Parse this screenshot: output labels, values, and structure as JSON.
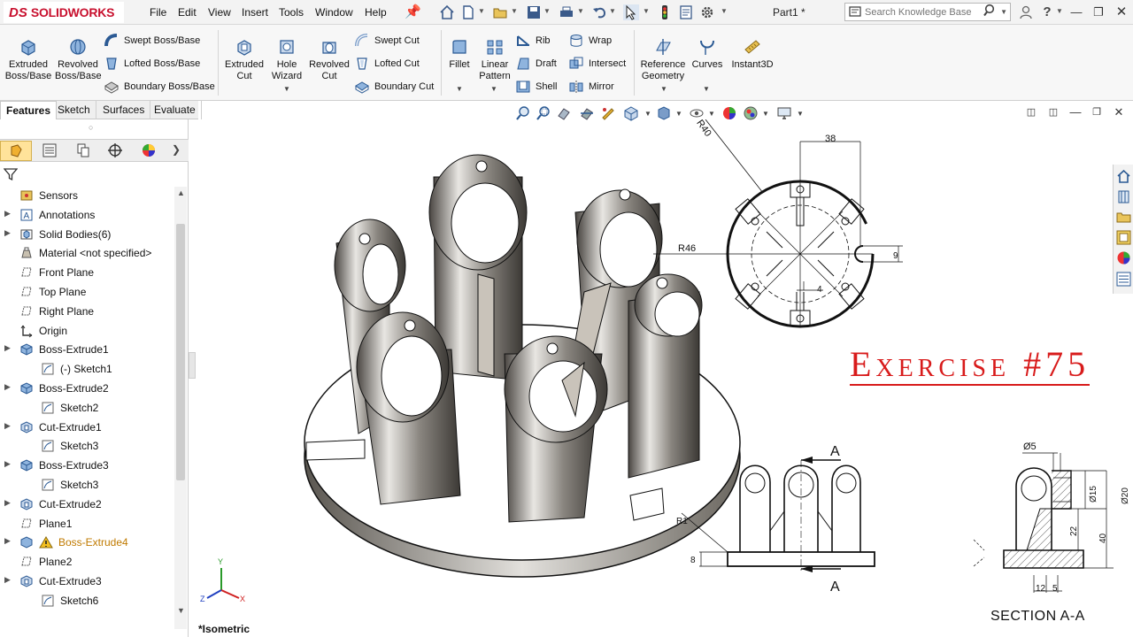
{
  "app": {
    "brand_ds": "DS",
    "brand_name": "SOLIDWORKS",
    "document_title": "Part1 *",
    "menu": [
      "File",
      "Edit",
      "View",
      "Insert",
      "Tools",
      "Window",
      "Help"
    ],
    "search_placeholder": "Search Knowledge Base",
    "accent_color": "#c8102e"
  },
  "ribbon": {
    "extruded_boss": "Extruded Boss/Base",
    "revolved_boss": "Revolved Boss/Base",
    "swept_boss": "Swept Boss/Base",
    "lofted_boss": "Lofted Boss/Base",
    "boundary_boss": "Boundary Boss/Base",
    "extruded_cut": "Extruded Cut",
    "hole_wizard": "Hole Wizard",
    "revolved_cut": "Revolved Cut",
    "swept_cut": "Swept Cut",
    "lofted_cut": "Lofted Cut",
    "boundary_cut": "Boundary Cut",
    "fillet": "Fillet",
    "linear_pattern": "Linear Pattern",
    "rib": "Rib",
    "draft": "Draft",
    "shell": "Shell",
    "wrap": "Wrap",
    "intersect": "Intersect",
    "mirror": "Mirror",
    "reference_geometry": "Reference Geometry",
    "curves": "Curves",
    "instant3d": "Instant3D"
  },
  "command_tabs": [
    "Features",
    "Sketch",
    "Surfaces",
    "Evaluate"
  ],
  "feature_tree": [
    {
      "label": "Sensors",
      "icon": "sensor-icon",
      "indent": 0,
      "expander": false
    },
    {
      "label": "Annotations",
      "icon": "annotation-icon",
      "indent": 0,
      "expander": true
    },
    {
      "label": "Solid Bodies(6)",
      "icon": "solid-bodies-icon",
      "indent": 0,
      "expander": true
    },
    {
      "label": "Material <not specified>",
      "icon": "material-icon",
      "indent": 0,
      "expander": false
    },
    {
      "label": "Front Plane",
      "icon": "plane-icon",
      "indent": 0,
      "expander": false
    },
    {
      "label": "Top Plane",
      "icon": "plane-icon",
      "indent": 0,
      "expander": false
    },
    {
      "label": "Right Plane",
      "icon": "plane-icon",
      "indent": 0,
      "expander": false
    },
    {
      "label": "Origin",
      "icon": "origin-icon",
      "indent": 0,
      "expander": false
    },
    {
      "label": "Boss-Extrude1",
      "icon": "extrude-icon",
      "indent": 0,
      "expander": true
    },
    {
      "label": "(-) Sketch1",
      "icon": "sketch-icon",
      "indent": 1,
      "expander": false
    },
    {
      "label": "Boss-Extrude2",
      "icon": "extrude-icon",
      "indent": 0,
      "expander": true
    },
    {
      "label": "Sketch2",
      "icon": "sketch-icon",
      "indent": 1,
      "expander": false
    },
    {
      "label": "Cut-Extrude1",
      "icon": "cut-icon",
      "indent": 0,
      "expander": true
    },
    {
      "label": "Sketch3",
      "icon": "sketch-icon",
      "indent": 1,
      "expander": false
    },
    {
      "label": "Boss-Extrude3",
      "icon": "extrude-icon",
      "indent": 0,
      "expander": true
    },
    {
      "label": "Sketch3",
      "icon": "sketch-icon",
      "indent": 1,
      "expander": false
    },
    {
      "label": "Cut-Extrude2",
      "icon": "cut-icon",
      "indent": 0,
      "expander": true
    },
    {
      "label": "Plane1",
      "icon": "plane-icon",
      "indent": 0,
      "expander": false
    },
    {
      "label": "Boss-Extrude4",
      "icon": "warning-icon",
      "indent": 0,
      "expander": true,
      "warning": true
    },
    {
      "label": "Plane2",
      "icon": "plane-icon",
      "indent": 0,
      "expander": false
    },
    {
      "label": "Cut-Extrude3",
      "icon": "cut-icon",
      "indent": 0,
      "expander": true
    },
    {
      "label": "Sketch6",
      "icon": "sketch-icon",
      "indent": 1,
      "expander": false
    }
  ],
  "graphics": {
    "exercise_title": "Exercise #75",
    "section_label": "SECTION A-A",
    "view_label": "*Isometric",
    "triad": {
      "x": "X",
      "y": "Y",
      "z": "Z"
    },
    "top_view_dims": {
      "r40": "R40",
      "r46": "R46",
      "d38": "38",
      "d9": "9",
      "d4": "4"
    },
    "front_view_dims": {
      "a_top": "A",
      "a_bottom": "A",
      "r1": "R1",
      "d8": "8"
    },
    "section_dims": {
      "d5": "Ø5",
      "d15": "Ø15",
      "d20": "Ø20",
      "d22": "22",
      "d40": "40",
      "d12": "12",
      "d5b": "5"
    }
  }
}
